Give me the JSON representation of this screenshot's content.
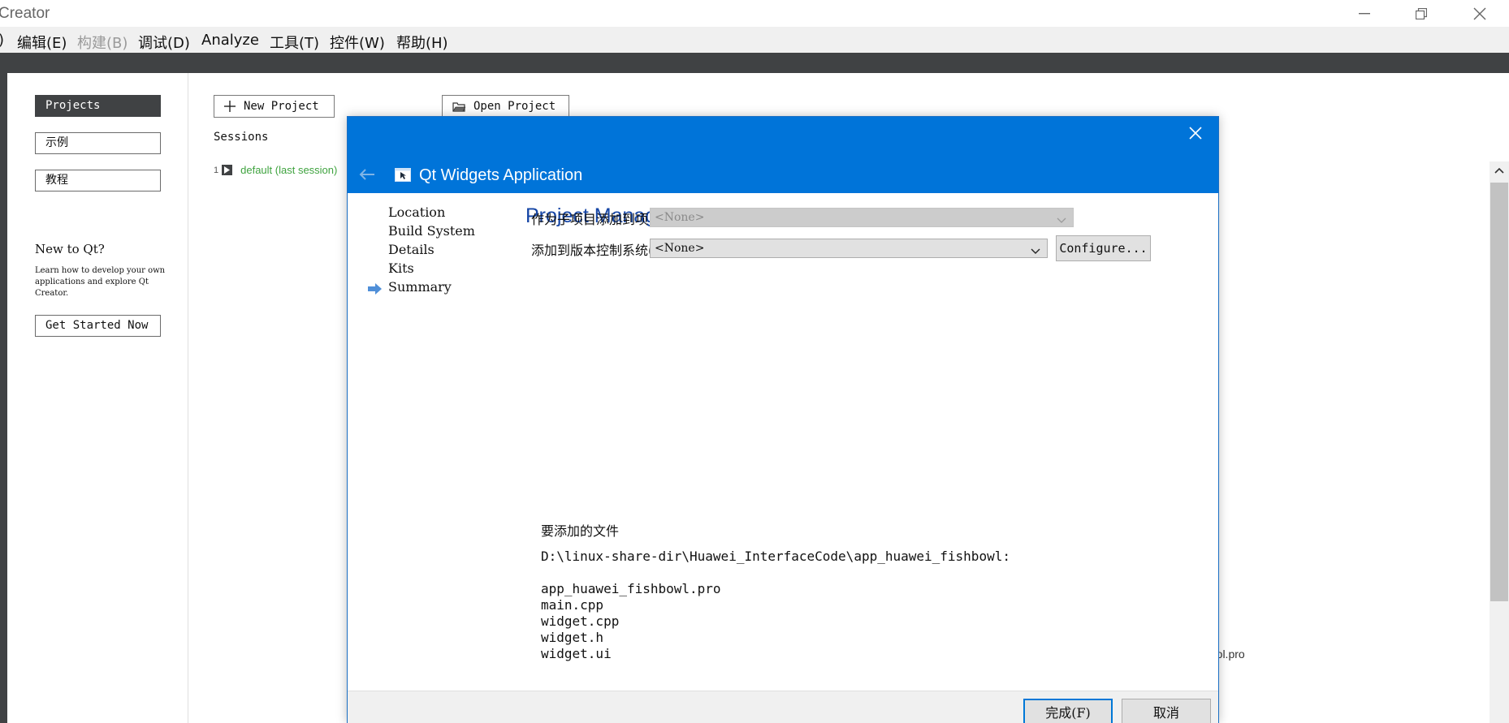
{
  "window": {
    "title": "Creator",
    "controls": [
      "minimize-icon",
      "restore-icon",
      "close-icon"
    ]
  },
  "menubar": {
    "items": [
      {
        "label": ")",
        "enabled": true
      },
      {
        "label": "编辑(E)",
        "enabled": true
      },
      {
        "label": "构建(B)",
        "enabled": false
      },
      {
        "label": "调试(D)",
        "enabled": true
      },
      {
        "label": "Analyze",
        "enabled": true
      },
      {
        "label": "工具(T)",
        "enabled": true
      },
      {
        "label": "控件(W)",
        "enabled": true
      },
      {
        "label": "帮助(H)",
        "enabled": true
      }
    ]
  },
  "welcome": {
    "side_buttons": [
      {
        "label": "Projects",
        "active": true
      },
      {
        "label": "示例",
        "active": false
      },
      {
        "label": "教程",
        "active": false
      }
    ],
    "new_to_qt": {
      "title": "New to Qt?",
      "text": "Learn how to develop your own applications and explore Qt Creator.",
      "button": "Get Started Now"
    },
    "new_project_label": "New Project",
    "open_project_label": "Open Project",
    "sessions_label": "Sessions",
    "sessions": [
      {
        "index": "1",
        "name": "default (last session)"
      }
    ],
    "recent_project_fragment": "rol.pro"
  },
  "dialog": {
    "title": "Qt Widgets Application",
    "steps": [
      {
        "label": "Location",
        "current": false
      },
      {
        "label": "Build System",
        "current": false
      },
      {
        "label": "Details",
        "current": false
      },
      {
        "label": "Kits",
        "current": false
      },
      {
        "label": "Summary",
        "current": true
      }
    ],
    "page_title": "Project Management",
    "add_to_project_label": "作为子项目添加到项目中:",
    "add_to_project_value": "<None>",
    "vcs_label": "添加到版本控制系统(V):",
    "vcs_value": "<None>",
    "configure_label": "Configure...",
    "files_label": "要添加的文件",
    "files_dir": "D:\\linux-share-dir\\Huawei_InterfaceCode\\app_huawei_fishbowl:",
    "files": [
      "app_huawei_fishbowl.pro",
      "main.cpp",
      "widget.cpp",
      "widget.h",
      "widget.ui"
    ],
    "finish_label": "完成(F)",
    "cancel_label": "取消"
  },
  "colors": {
    "dialog_header": "#0074d9",
    "page_title": "#1545a5",
    "session_link": "#3fa33f",
    "dark_bar": "#404244"
  }
}
